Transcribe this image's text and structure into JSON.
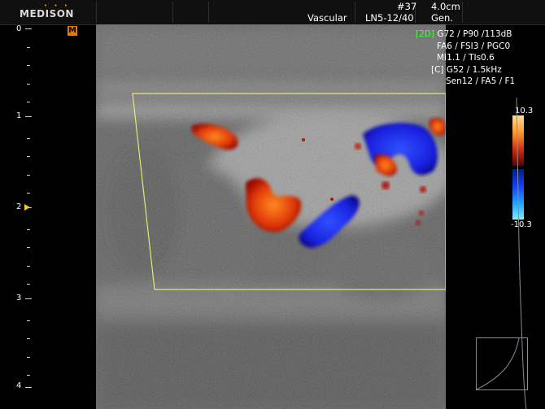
{
  "header": {
    "brand": "MEDISON",
    "brand_dots": "• • •",
    "frame_number": "#37",
    "depth": "4.0cm",
    "application": "Vascular",
    "probe": "LN5-12/40",
    "preset": "Gen."
  },
  "mode_badge": "M",
  "depth_scale": {
    "labels": [
      "0",
      "1",
      "2",
      "3",
      "4"
    ],
    "focus_depth_cm": 2.0
  },
  "parameters": {
    "mode_2d_tag": "[2D]",
    "line_2d_1": "G72 / P90 /113dB",
    "line_2d_2": "FA6 / FSI3 / PGC0",
    "line_2d_3": "MI1.1 / TIs0.6",
    "line_c_1": "[C] G52 / 1.5kHz",
    "line_c_2": "Sen12 / FA5 / F1"
  },
  "color_scale": {
    "max_label": "10.3",
    "min_label": "-10.3"
  },
  "colors": {
    "flow_red": "#d02000",
    "flow_blue": "#1a2cff",
    "roi_box": "#e8e870",
    "param_green": "#40ff40",
    "mode_badge": "#e57c00"
  }
}
